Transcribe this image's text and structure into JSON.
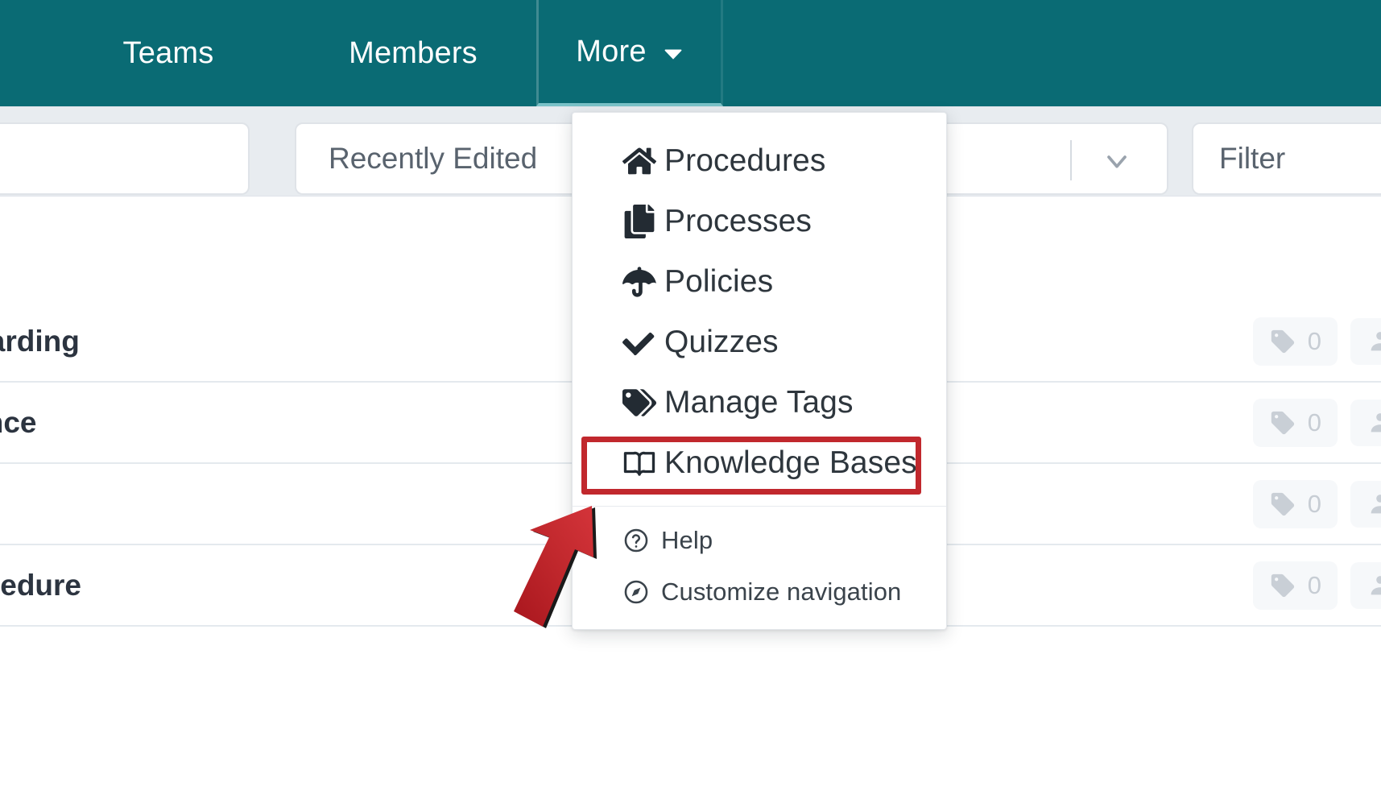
{
  "topnav": {
    "background_color": "#0a6b74",
    "tabs": [
      {
        "label": "Teams",
        "active": false
      },
      {
        "label": "Members",
        "active": false
      },
      {
        "label": "More",
        "active": true,
        "caret_icon": "chevron-down-icon"
      }
    ]
  },
  "toolbar": {
    "search": {
      "value": "",
      "placeholder": ""
    },
    "sort": {
      "value": "Recently Edited",
      "caret_icon": "chevron-down-icon"
    },
    "filter": {
      "label": "Filter"
    }
  },
  "dropdown": {
    "items": [
      {
        "label": "Procedures",
        "icon": "home-icon"
      },
      {
        "label": "Processes",
        "icon": "copy-documents-icon"
      },
      {
        "label": "Policies",
        "icon": "umbrella-icon"
      },
      {
        "label": "Quizzes",
        "icon": "check-icon"
      },
      {
        "label": "Manage Tags",
        "icon": "tag-icon"
      },
      {
        "label": "Knowledge Bases",
        "icon": "open-book-icon",
        "highlighted": true
      }
    ],
    "footer_items": [
      {
        "label": "Help",
        "icon": "question-circle-icon"
      },
      {
        "label": "Customize navigation",
        "icon": "compass-icon"
      }
    ]
  },
  "annotations": {
    "highlight_color": "#c1282d",
    "arrow_color": "#c1282d",
    "target": "Knowledge Bases"
  },
  "list": {
    "rows": [
      {
        "title": "nboarding",
        "tag_count": "0"
      },
      {
        "title": "enance",
        "tag_count": "0"
      },
      {
        "title": "",
        "tag_count": "0"
      },
      {
        "title": "Procedure",
        "tag_count": "0"
      }
    ]
  }
}
